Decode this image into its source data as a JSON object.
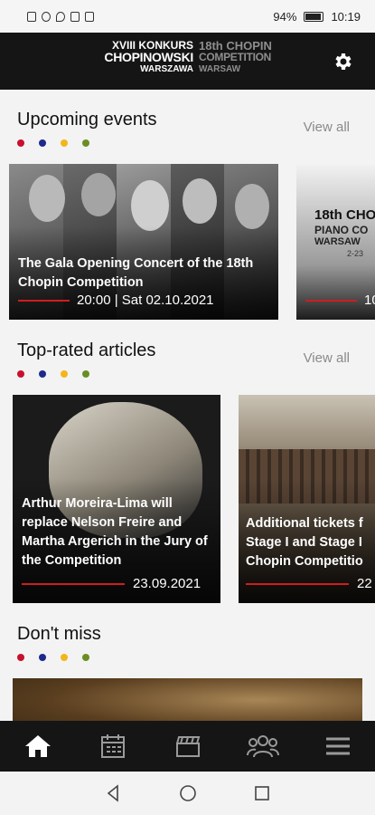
{
  "status_bar": {
    "battery": "94%",
    "time": "10:19"
  },
  "header": {
    "logo_left": [
      "XVIII KONKURS",
      "CHOPINOWSKI",
      "WARSZAWA"
    ],
    "logo_right": [
      "18th CHOPIN",
      "COMPETITION",
      "WARSAW"
    ],
    "settings_icon": "gear-icon"
  },
  "accent_dots": [
    "#c8102e",
    "#1d2a8c",
    "#f2b51c",
    "#6b8e23"
  ],
  "sections": {
    "upcoming": {
      "title": "Upcoming events",
      "view_all": "View all",
      "cards": [
        {
          "title": "The Gala Opening Concert of the 18th Chopin Competition",
          "date": "20:00 | Sat 02.10.2021"
        },
        {
          "title": "",
          "date": "10",
          "poster_lines": [
            "18th CHOP",
            "PIANO CO",
            "WARSAW",
            "2-23"
          ]
        }
      ]
    },
    "articles": {
      "title": "Top-rated articles",
      "view_all": "View all",
      "cards": [
        {
          "title": "Arthur Moreira-Lima will replace Nelson Freire and Martha Argerich in the Jury of the Competition",
          "date": "23.09.2021"
        },
        {
          "title": "Additional tickets f Stage I and Stage I Chopin Competitio",
          "date": "22"
        }
      ]
    },
    "dont_miss": {
      "title": "Don't miss"
    }
  },
  "bottom_nav": [
    {
      "name": "home",
      "icon": "home-icon"
    },
    {
      "name": "calendar",
      "icon": "calendar-icon"
    },
    {
      "name": "video",
      "icon": "clapperboard-icon"
    },
    {
      "name": "people",
      "icon": "people-icon"
    },
    {
      "name": "menu",
      "icon": "menu-icon"
    }
  ]
}
